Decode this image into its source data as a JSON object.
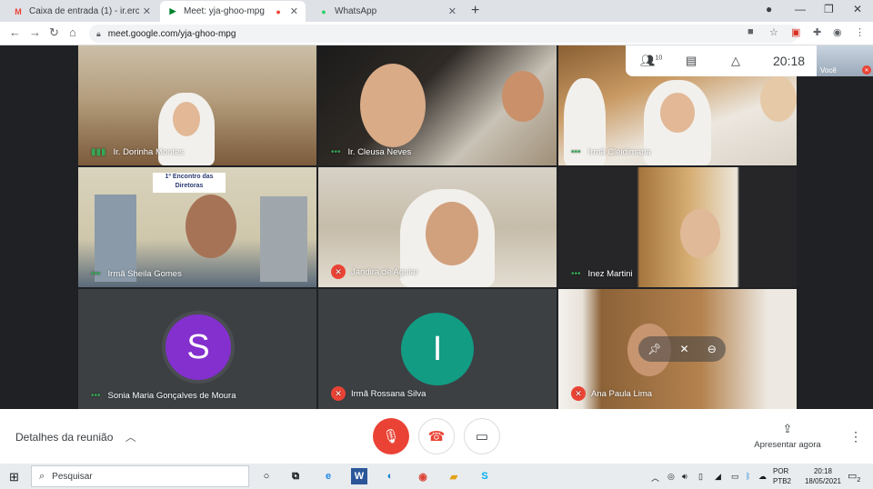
{
  "browser": {
    "tabs": [
      {
        "title": "Caixa de entrada (1) - ir.ercilia.m",
        "icon": "gmail-icon",
        "color": "#ea4335"
      },
      {
        "title": "Meet: yja-ghoo-mpg",
        "icon": "meet-icon",
        "color": "#00832d"
      },
      {
        "title": "WhatsApp",
        "icon": "whatsapp-icon",
        "color": "#25d366"
      }
    ],
    "url": "meet.google.com/yja-ghoo-mpg"
  },
  "meet": {
    "participant_count": "10",
    "time": "20:18",
    "self_label": "Você",
    "participants": [
      {
        "name": "Ir. Dorinha Montes"
      },
      {
        "name": "Ir. Cleusa Neves"
      },
      {
        "name": "Irmã Cleidimaria"
      },
      {
        "name": "Irmã Sheila Gomes"
      },
      {
        "name": "Jandira de Aguiar"
      },
      {
        "name": "Inez Martini"
      },
      {
        "name": "Sonia Maria Gonçalves de Moura",
        "initial": "S",
        "avatar_color": "#8430ce"
      },
      {
        "name": "Irmã Rossana Silva",
        "initial": "I",
        "avatar_color": "#129c84"
      },
      {
        "name": "Ana Paula Lima"
      }
    ],
    "slide_text": "1º Encontro das Diretoras",
    "details_label": "Detalhes da reunião",
    "present_label": "Apresentar agora"
  },
  "taskbar": {
    "search_placeholder": "Pesquisar",
    "lang_line1": "POR",
    "lang_line2": "PTB2",
    "clock_time": "20:18",
    "clock_date": "18/05/2021",
    "notification_count": "2"
  }
}
